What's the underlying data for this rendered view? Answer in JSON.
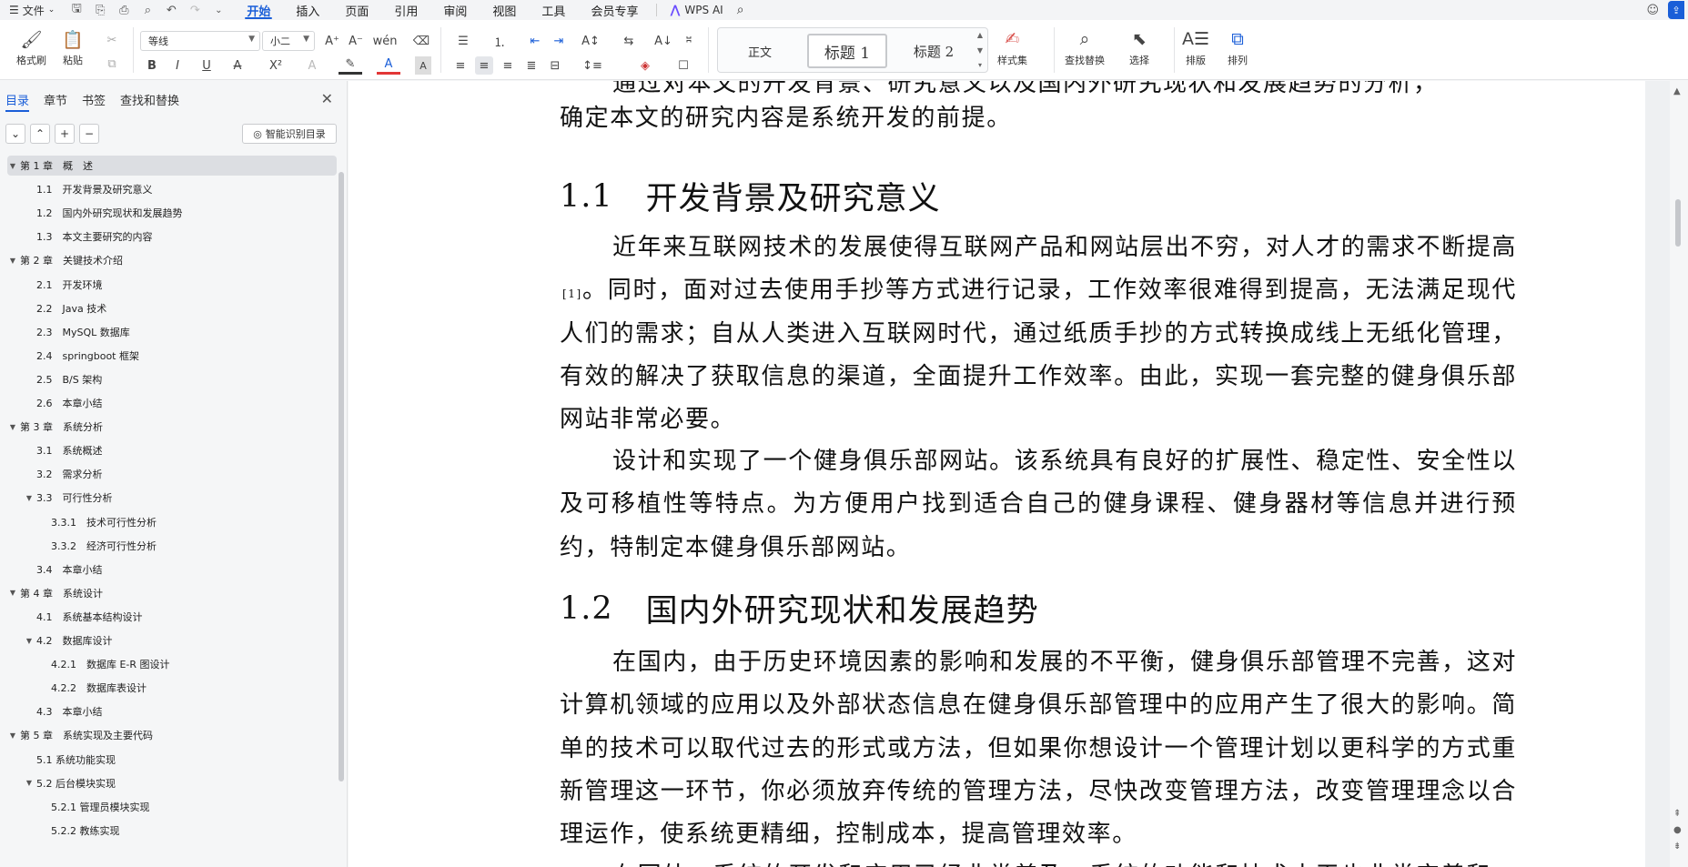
{
  "menubar": {
    "file": "文件",
    "tabs": [
      "开始",
      "插入",
      "页面",
      "引用",
      "审阅",
      "视图",
      "工具",
      "会员专享"
    ],
    "active_tab": "开始",
    "wps_ai": "WPS AI"
  },
  "ribbon": {
    "format_painter": "格式刷",
    "paste": "粘贴",
    "font_name": "等线",
    "font_size": "小二",
    "style_normal": "正文",
    "style_h1": "标题 1",
    "style_h2": "标题 2",
    "style_set": "样式集",
    "find_replace": "查找替换",
    "select": "选择",
    "layout": "排版",
    "arrange": "排列"
  },
  "nav": {
    "tabs": [
      "目录",
      "章节",
      "书签",
      "查找和替换"
    ],
    "active_tab": "目录",
    "smart_button": "智能识别目录",
    "items": [
      {
        "label": "第 1 章　概　述",
        "level": 0,
        "expand": "▼",
        "selected": true
      },
      {
        "label": "1.1　开发背景及研究意义",
        "level": 1,
        "expand": ""
      },
      {
        "label": "1.2　国内外研究现状和发展趋势",
        "level": 1,
        "expand": ""
      },
      {
        "label": "1.3　本文主要研究的内容",
        "level": 1,
        "expand": ""
      },
      {
        "label": "第 2 章　关键技术介绍",
        "level": 0,
        "expand": "▼"
      },
      {
        "label": "2.1　开发环境",
        "level": 1,
        "expand": ""
      },
      {
        "label": "2.2　Java 技术",
        "level": 1,
        "expand": ""
      },
      {
        "label": "2.3　MySQL 数据库",
        "level": 1,
        "expand": ""
      },
      {
        "label": "2.4　springboot 框架",
        "level": 1,
        "expand": ""
      },
      {
        "label": "2.5　B/S 架构",
        "level": 1,
        "expand": ""
      },
      {
        "label": "2.6　本章小结",
        "level": 1,
        "expand": ""
      },
      {
        "label": "第 3 章　系统分析",
        "level": 0,
        "expand": "▼"
      },
      {
        "label": "3.1　系统概述",
        "level": 1,
        "expand": ""
      },
      {
        "label": "3.2　需求分析",
        "level": 1,
        "expand": ""
      },
      {
        "label": "3.3　可行性分析",
        "level": 1,
        "expand": "▼"
      },
      {
        "label": "3.3.1　技术可行性分析",
        "level": 2,
        "expand": ""
      },
      {
        "label": "3.3.2　经济可行性分析",
        "level": 2,
        "expand": ""
      },
      {
        "label": "3.4　本章小结",
        "level": 1,
        "expand": ""
      },
      {
        "label": "第 4 章　系统设计",
        "level": 0,
        "expand": "▼"
      },
      {
        "label": "4.1　系统基本结构设计",
        "level": 1,
        "expand": ""
      },
      {
        "label": "4.2　数据库设计",
        "level": 1,
        "expand": "▼"
      },
      {
        "label": "4.2.1　数据库 E-R 图设计",
        "level": 2,
        "expand": ""
      },
      {
        "label": "4.2.2　数据库表设计",
        "level": 2,
        "expand": ""
      },
      {
        "label": "4.3　本章小结",
        "level": 1,
        "expand": ""
      },
      {
        "label": "第 5 章　系统实现及主要代码",
        "level": 0,
        "expand": "▼"
      },
      {
        "label": "5.1 系统功能实现",
        "level": 1,
        "expand": ""
      },
      {
        "label": "5.2 后台模块实现",
        "level": 1,
        "expand": "▼"
      },
      {
        "label": "5.2.1 管理员模块实现",
        "level": 2,
        "expand": ""
      },
      {
        "label": "5.2.2 教练实现",
        "level": 2,
        "expand": ""
      }
    ]
  },
  "document": {
    "cut_top_line": "通过对本文的开发背景、研究意义以及国内外研究现状和发展趋势的分析，",
    "p0_tail": "确定本文的研究内容是系统开发的前提。",
    "h11_num": "1.1",
    "h11_title": "开发背景及研究意义",
    "p1_a": "近年来互联网技术的发展使得互联网产品和网站层出不穷，对人才的需求不断提高",
    "p1_ref": "[1]",
    "p1_b": "。同时，面对过去使用手抄等方式进行记录，工作效率很难得到提高，无法满足现代人们的需求；自从人类进入互联网时代，通过纸质手抄的方式转换成线上无纸化管理，有效的解决了获取信息的渠道，全面提升工作效率。由此，实现一套完整的健身俱乐部网站非常必要。",
    "p2": "设计和实现了一个健身俱乐部网站。该系统具有良好的扩展性、稳定性、安全性以及可移植性等特点。为方便用户找到适合自己的健身课程、健身器材等信息并进行预约，特制定本健身俱乐部网站。",
    "h12_num": "1.2",
    "h12_title": "国内外研究现状和发展趋势",
    "p3": "在国内，由于历史环境因素的影响和发展的不平衡，健身俱乐部管理不完善，这对计算机领域的应用以及外部状态信息在健身俱乐部管理中的应用产生了很大的影响。简单的技术可以取代过去的形式或方法，但如果你想设计一个管理计划以更科学的方式重新管理这一环节，你必须放弃传统的管理方法，尽快改变管理方法，改变管理理念以合理运作，使系统更精细，控制成本，提高管理效率。",
    "cut_bottom_line": "在国外，系统的开发和应用已经非常普及，系统的功能和技术水平也非常完善和"
  }
}
